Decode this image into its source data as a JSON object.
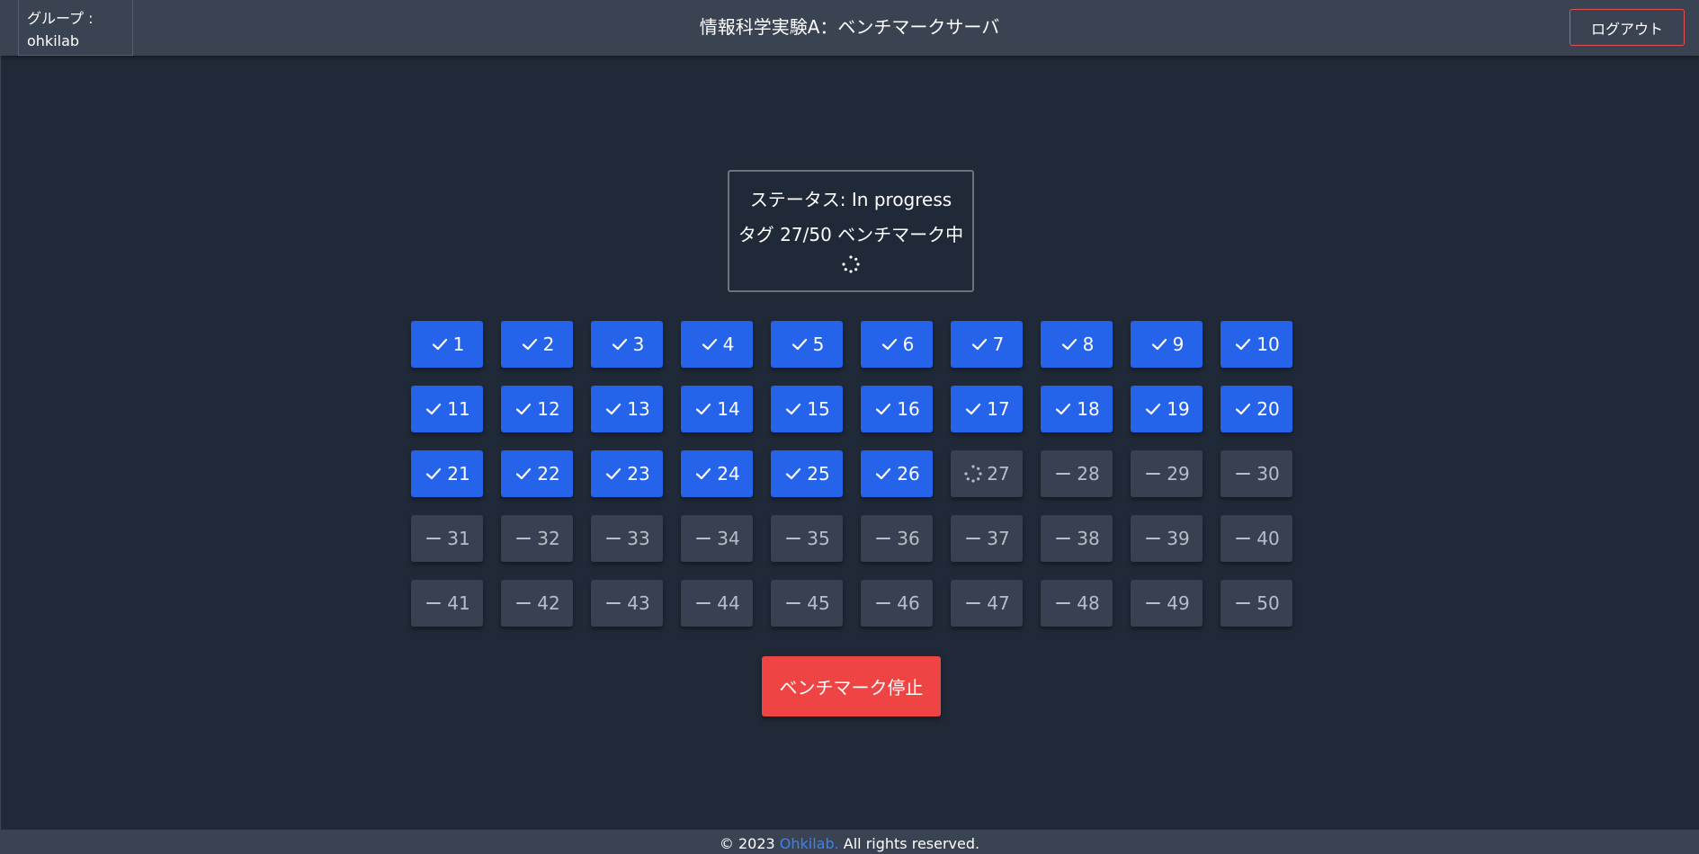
{
  "header": {
    "group_label": "グループ :",
    "group_name": "ohkilab",
    "title": "情報科学実験A：ベンチマークサーバ",
    "logout_label": "ログアウト"
  },
  "status": {
    "status_text": "ステータス: In progress",
    "progress_text": "タグ 27/50 ベンチマーク中",
    "spinner_icon": "spinner-icon"
  },
  "tags": [
    {
      "label": "1",
      "state": "done"
    },
    {
      "label": "2",
      "state": "done"
    },
    {
      "label": "3",
      "state": "done"
    },
    {
      "label": "4",
      "state": "done"
    },
    {
      "label": "5",
      "state": "done"
    },
    {
      "label": "6",
      "state": "done"
    },
    {
      "label": "7",
      "state": "done"
    },
    {
      "label": "8",
      "state": "done"
    },
    {
      "label": "9",
      "state": "done"
    },
    {
      "label": "10",
      "state": "done"
    },
    {
      "label": "11",
      "state": "done"
    },
    {
      "label": "12",
      "state": "done"
    },
    {
      "label": "13",
      "state": "done"
    },
    {
      "label": "14",
      "state": "done"
    },
    {
      "label": "15",
      "state": "done"
    },
    {
      "label": "16",
      "state": "done"
    },
    {
      "label": "17",
      "state": "done"
    },
    {
      "label": "18",
      "state": "done"
    },
    {
      "label": "19",
      "state": "done"
    },
    {
      "label": "20",
      "state": "done"
    },
    {
      "label": "21",
      "state": "done"
    },
    {
      "label": "22",
      "state": "done"
    },
    {
      "label": "23",
      "state": "done"
    },
    {
      "label": "24",
      "state": "done"
    },
    {
      "label": "25",
      "state": "done"
    },
    {
      "label": "26",
      "state": "done"
    },
    {
      "label": "27",
      "state": "running"
    },
    {
      "label": "28",
      "state": "pending"
    },
    {
      "label": "29",
      "state": "pending"
    },
    {
      "label": "30",
      "state": "pending"
    },
    {
      "label": "31",
      "state": "pending"
    },
    {
      "label": "32",
      "state": "pending"
    },
    {
      "label": "33",
      "state": "pending"
    },
    {
      "label": "34",
      "state": "pending"
    },
    {
      "label": "35",
      "state": "pending"
    },
    {
      "label": "36",
      "state": "pending"
    },
    {
      "label": "37",
      "state": "pending"
    },
    {
      "label": "38",
      "state": "pending"
    },
    {
      "label": "39",
      "state": "pending"
    },
    {
      "label": "40",
      "state": "pending"
    },
    {
      "label": "41",
      "state": "pending"
    },
    {
      "label": "42",
      "state": "pending"
    },
    {
      "label": "43",
      "state": "pending"
    },
    {
      "label": "44",
      "state": "pending"
    },
    {
      "label": "45",
      "state": "pending"
    },
    {
      "label": "46",
      "state": "pending"
    },
    {
      "label": "47",
      "state": "pending"
    },
    {
      "label": "48",
      "state": "pending"
    },
    {
      "label": "49",
      "state": "pending"
    },
    {
      "label": "50",
      "state": "pending"
    }
  ],
  "state_icons": {
    "done": "check-icon",
    "running": "spinner-icon",
    "pending": "dash-icon"
  },
  "actions": {
    "stop_label": "ベンチマーク停止"
  },
  "footer": {
    "copyright_prefix": "© 2023 ",
    "brand_link": "Ohkilab.",
    "copyright_suffix": " All rights reserved."
  },
  "colors": {
    "background": "#202937",
    "header": "#3a4352",
    "done_tag": "#2563eb",
    "pending_tag": "#374151",
    "stop_button": "#ef4444",
    "logout_border": "#e05252",
    "link": "#3b82f6"
  }
}
